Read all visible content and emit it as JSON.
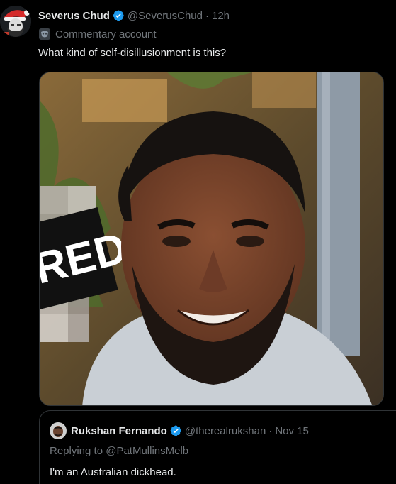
{
  "tweet": {
    "author_name": "Severus Chud",
    "handle": "@SeverusChud",
    "time": "12h",
    "account_label": "Commentary account",
    "text": "What kind of self-disillusionment is this?",
    "media": {
      "sign_text": "RED"
    }
  },
  "quote": {
    "author_name": "Rukshan Fernando",
    "handle": "@therealrukshan",
    "date": "Nov 15",
    "replying_prefix": "Replying to",
    "replying_to": "@PatMullinsMelb",
    "text": "I'm an Australian dickhead."
  },
  "colors": {
    "background": "#000000",
    "primary_text": "#e7e9ea",
    "secondary_text": "#71767b",
    "verified_blue": "#1d9bf0",
    "border": "#2f3336"
  },
  "icons": {
    "verified": "verified-badge-icon",
    "label": "commentary-label-icon"
  }
}
